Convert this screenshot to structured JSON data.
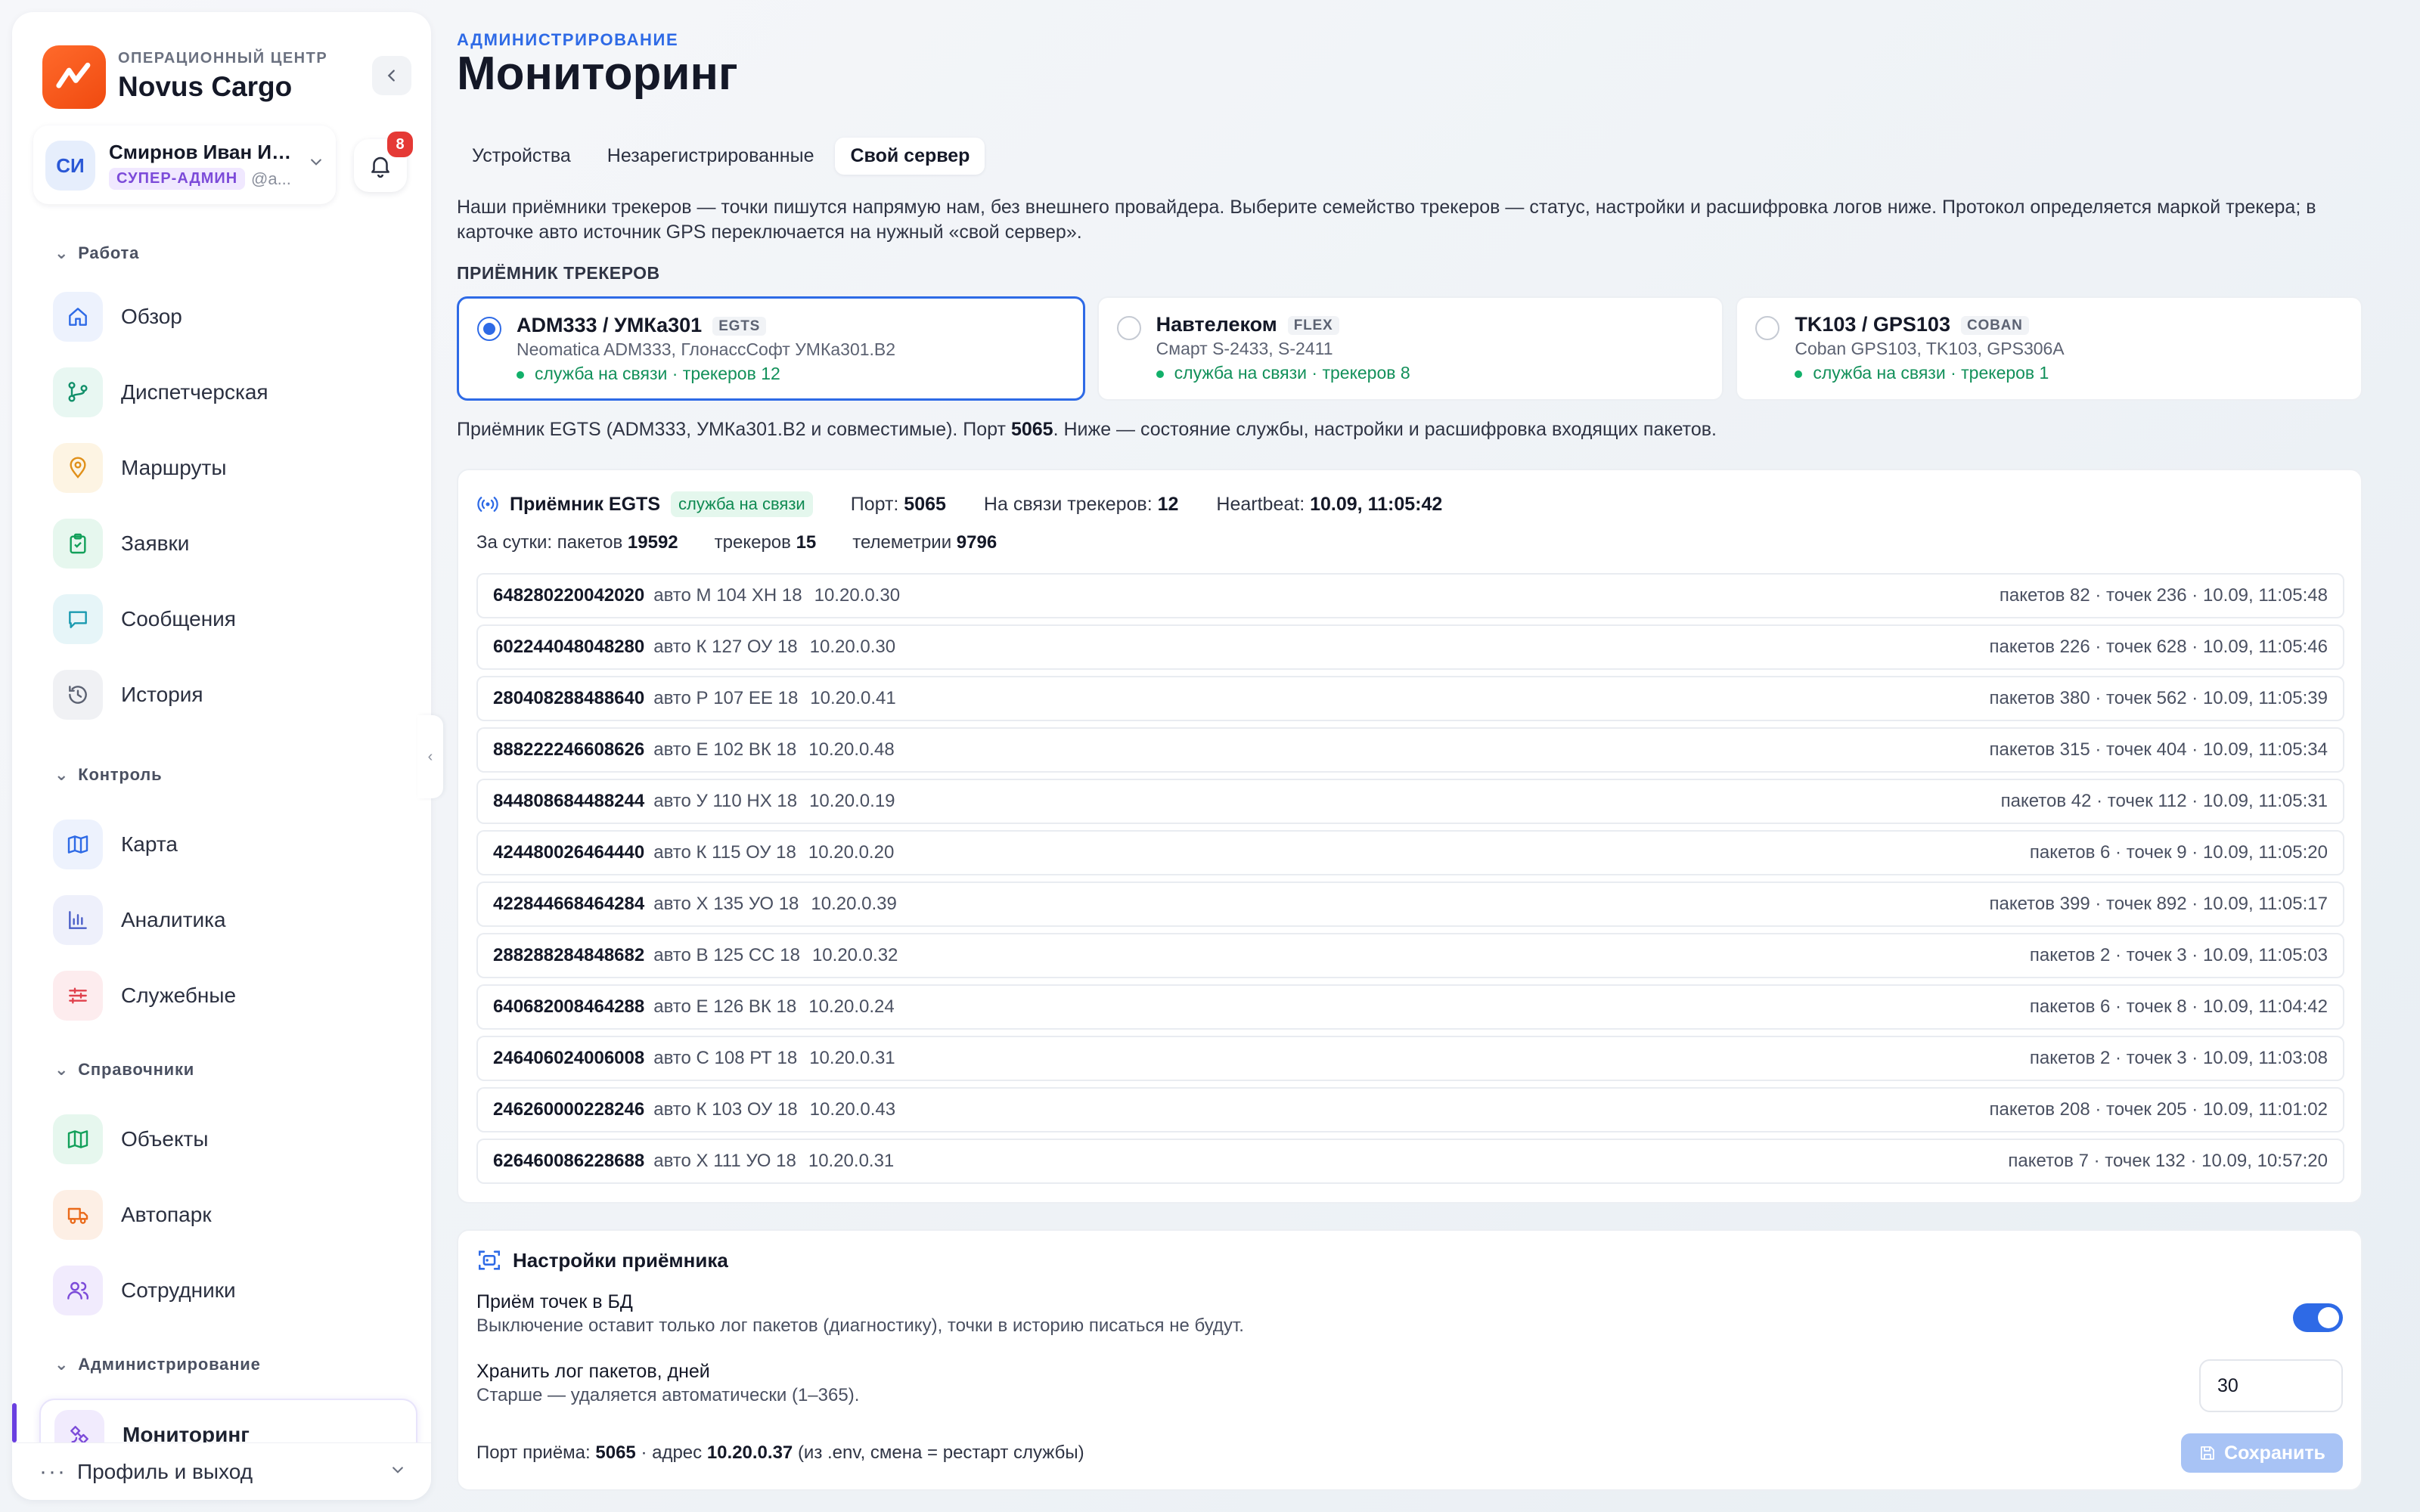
{
  "brand": {
    "subtitle": "ОПЕРАЦИОННЫЙ ЦЕНТР",
    "name": "Novus Cargo"
  },
  "user": {
    "initials": "СИ",
    "name": "Смирнов Иван Ив...",
    "role": "СУПЕР-АДМИН",
    "handle": "@a...",
    "notifications": "8"
  },
  "nav": {
    "sections": [
      {
        "title": "Работа",
        "items": [
          {
            "label": "Обзор",
            "icon": "home-icon"
          },
          {
            "label": "Диспетчерская",
            "icon": "route-branch-icon"
          },
          {
            "label": "Маршруты",
            "icon": "map-pin-icon"
          },
          {
            "label": "Заявки",
            "icon": "clipboard-icon"
          },
          {
            "label": "Сообщения",
            "icon": "chat-icon"
          },
          {
            "label": "История",
            "icon": "history-icon"
          }
        ]
      },
      {
        "title": "Контроль",
        "items": [
          {
            "label": "Карта",
            "icon": "map-icon"
          },
          {
            "label": "Аналитика",
            "icon": "chart-icon"
          },
          {
            "label": "Служебные",
            "icon": "sliders-icon"
          }
        ]
      },
      {
        "title": "Справочники",
        "items": [
          {
            "label": "Объекты",
            "icon": "map-icon"
          },
          {
            "label": "Автопарк",
            "icon": "truck-icon"
          },
          {
            "label": "Сотрудники",
            "icon": "users-icon"
          }
        ]
      },
      {
        "title": "Администрирование",
        "items": [
          {
            "label": "Мониторинг",
            "icon": "satellite-icon"
          }
        ]
      }
    ],
    "profile": "Профиль и выход"
  },
  "header": {
    "eyebrow": "АДМИНИСТРИРОВАНИЕ",
    "title": "Мониторинг"
  },
  "tabs": [
    "Устройства",
    "Незарегистрированные",
    "Свой сервер"
  ],
  "active_tab": "Свой сервер",
  "intro": "Наши приёмники трекеров — точки пишутся напрямую нам, без внешнего провайдера. Выберите семейство трекеров — статус, настройки и расшифровка логов ниже. Протокол определяется маркой трекера; в карточке авто источник GPS переключается на нужный «свой сервер».",
  "receivers_label": "ПРИЁМНИК ТРЕКЕРОВ",
  "receivers": [
    {
      "title": "ADM333 / УМКа301",
      "tag": "EGTS",
      "models": "Neomatica ADM333, ГлонассСофт УМКа301.В2",
      "status": "служба на связи · трекеров 12",
      "selected": true
    },
    {
      "title": "Навтелеком",
      "tag": "FLEX",
      "models": "Смарт S-2433, S-2411",
      "status": "служба на связи · трекеров 8",
      "selected": false
    },
    {
      "title": "TK103 / GPS103",
      "tag": "COBAN",
      "models": "Coban GPS103, TK103, GPS306A",
      "status": "служба на связи · трекеров 1",
      "selected": false
    }
  ],
  "receiver_desc": {
    "prefix": "Приёмник EGTS (ADM333, УМКа301.В2 и совместимые). Порт ",
    "port": "5065",
    "suffix": ". Ниже — состояние службы, настройки и расшифровка входящих пакетов."
  },
  "service": {
    "name": "Приёмник EGTS",
    "status": "служба на связи",
    "port_label": "Порт:",
    "port": "5065",
    "online_label": "На связи трекеров:",
    "online": "12",
    "heartbeat_label": "Heartbeat:",
    "heartbeat": "10.09, 11:05:42",
    "day_label": "За сутки: пакетов",
    "day_packets": "19592",
    "trackers_label": "трекеров",
    "trackers": "15",
    "telemetry_label": "телеметрии",
    "telemetry": "9796"
  },
  "trackers": [
    {
      "imei": "648280220042020",
      "car": "авто М 104 ХН 18",
      "ip": "10.20.0.30",
      "stat": "пакетов 82 · точек 236 · 10.09, 11:05:48"
    },
    {
      "imei": "602244048048280",
      "car": "авто К 127 ОУ 18",
      "ip": "10.20.0.30",
      "stat": "пакетов 226 · точек 628 · 10.09, 11:05:46"
    },
    {
      "imei": "280408288488640",
      "car": "авто Р 107 ЕЕ 18",
      "ip": "10.20.0.41",
      "stat": "пакетов 380 · точек 562 · 10.09, 11:05:39"
    },
    {
      "imei": "888222246608626",
      "car": "авто Е 102 ВК 18",
      "ip": "10.20.0.48",
      "stat": "пакетов 315 · точек 404 · 10.09, 11:05:34"
    },
    {
      "imei": "844808684488244",
      "car": "авто У 110 НХ 18",
      "ip": "10.20.0.19",
      "stat": "пакетов 42 · точек 112 · 10.09, 11:05:31"
    },
    {
      "imei": "424480026464440",
      "car": "авто К 115 ОУ 18",
      "ip": "10.20.0.20",
      "stat": "пакетов 6 · точек 9 · 10.09, 11:05:20"
    },
    {
      "imei": "422844668464284",
      "car": "авто Х 135 УО 18",
      "ip": "10.20.0.39",
      "stat": "пакетов 399 · точек 892 · 10.09, 11:05:17"
    },
    {
      "imei": "288288284848682",
      "car": "авто В 125 СС 18",
      "ip": "10.20.0.32",
      "stat": "пакетов 2 · точек 3 · 10.09, 11:05:03"
    },
    {
      "imei": "640682008464288",
      "car": "авто Е 126 ВК 18",
      "ip": "10.20.0.24",
      "stat": "пакетов 6 · точек 8 · 10.09, 11:04:42"
    },
    {
      "imei": "246406024006008",
      "car": "авто С 108 РТ 18",
      "ip": "10.20.0.31",
      "stat": "пакетов 2 · точек 3 · 10.09, 11:03:08"
    },
    {
      "imei": "246260000228246",
      "car": "авто К 103 ОУ 18",
      "ip": "10.20.0.43",
      "stat": "пакетов 208 · точек 205 · 10.09, 11:01:02"
    },
    {
      "imei": "626460086228688",
      "car": "авто Х 111 УО 18",
      "ip": "10.20.0.31",
      "stat": "пакетов 7 · точек 132 · 10.09, 10:57:20"
    }
  ],
  "settings": {
    "title": "Настройки приёмника",
    "db_title": "Приём точек в БД",
    "db_desc": "Выключение оставит только лог пакетов (диагностику), точки в историю писаться не будут.",
    "db_enabled": true,
    "log_title": "Хранить лог пакетов, дней",
    "log_desc": "Старше — удаляется автоматически (1–365).",
    "log_days": "30",
    "port_prefix": "Порт приёма:",
    "port": "5065",
    "addr_prefix": "· адрес",
    "addr": "10.20.0.37",
    "addr_suffix": "(из .env, смена = рестарт службы)",
    "save": "Сохранить"
  },
  "colors": {
    "accent": "#2e6ae6",
    "brand": "#f04a10",
    "success": "#12b06a",
    "active_nav": "#6a3fe0"
  }
}
